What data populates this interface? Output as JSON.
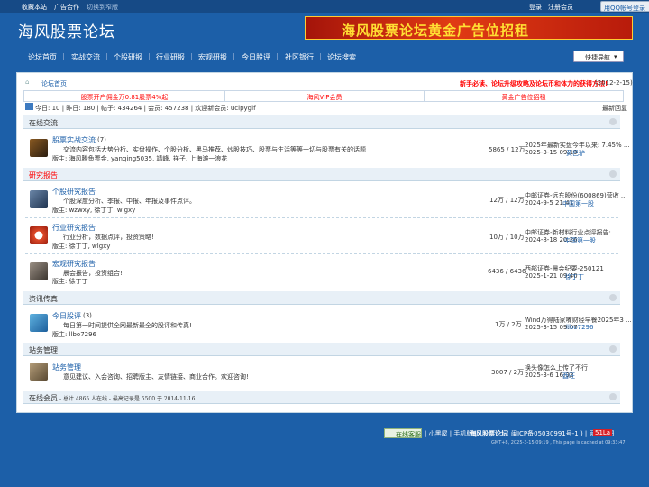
{
  "topbar": {
    "fav": "收藏本站",
    "ads": "广告合作",
    "switch_width": "切换到窄版",
    "login": "登录",
    "register": "注册会员",
    "qq_login": "用QQ帐号登录"
  },
  "logo": "海风股票论坛",
  "banner": "海风股票论坛黄金广告位招租",
  "nav": [
    "论坛首页",
    "实战交流",
    "个股研报",
    "行业研报",
    "宏观研报",
    "今日股评",
    "社区银行",
    "论坛搜索"
  ],
  "quick_nav": "快捷导航",
  "breadcrumb": "论坛首页",
  "notice": "新手必读、论坛升级攻略及论坛币和体力的获得方法!",
  "notice_date": "(2012-2-15)",
  "ads": [
    "股票开户佣金万0.81股票4%起",
    "海风VIP会员",
    "黄金广告位招租"
  ],
  "stats": {
    "text": "今日: 10 | 昨日: 180 | 帖子: 434264 | 会员: 457238 | 欢迎新会员: ucipygif",
    "latest": "最新回复"
  },
  "sections": [
    {
      "name": "在线交流",
      "forums": [
        {
          "title": "股票实战交流",
          "count": "(7)",
          "desc": "交流内容包括大势分析、实盘操作、个股分析、黑马推荐、炒股技巧、股票与生活等等一切与股票有关的话题",
          "mods": "版主: 海风腾鱼票金, yanqing5035, 靖峰, 祥子, 上海滩一浪花",
          "stats": "5865 / 12万",
          "last_title": "2025年最新实盘今年以来: 7.45% ...",
          "last_time": "2025-3-15 09:19",
          "last_user": "黄巴驴"
        }
      ]
    },
    {
      "name": "研究报告",
      "forums": [
        {
          "title": "个股研究报告",
          "count": "",
          "desc": "个股深度分析、季报、中报、年报及事件点评。",
          "mods": "版主: wzwxy, 徐丁丁, wlgxy",
          "stats": "12万 / 12万",
          "last_title": "中邮证券-远东股份(600869)营收 ...",
          "last_time": "2024-9-5 21:41",
          "last_user": "中国第一股"
        },
        {
          "title": "行业研究报告",
          "count": "",
          "desc": "行业分析，数据点评，投资策略!",
          "mods": "版主: 徐丁丁, wlgxy",
          "stats": "10万 / 10万",
          "last_title": "中邮证券-新材料行业点评报告: ...",
          "last_time": "2024-8-18 20:26",
          "last_user": "中国第一股"
        },
        {
          "title": "宏观研究报告",
          "count": "",
          "desc": "晨会报告，投资组合!",
          "mods": "版主: 徐丁丁",
          "stats": "6436 / 6436",
          "last_title": "西部证券-晨会纪要-250121",
          "last_time": "2025-1-21 09:40",
          "last_user": "徐丁丁"
        }
      ]
    },
    {
      "name": "资讯传真",
      "forums": [
        {
          "title": "今日股评",
          "count": "(3)",
          "desc": "每日第一时间提供全网最新最全的股评和传真!",
          "mods": "版主: llbo7296",
          "stats": "1万 / 2万",
          "last_title": "Wind万得陆家嘴财经早餐2025年3 ...",
          "last_time": "2025-3-15 09:07",
          "last_user": "llbo7296"
        }
      ]
    },
    {
      "name": "站务管理",
      "forums": [
        {
          "title": "站务管理",
          "count": "",
          "desc": "意见建议、入会咨询、招聘版主、友情链接、商业合作。欢迎咨询!",
          "mods": "",
          "stats": "3007 / 2万",
          "last_title": "换头像怎么上传了不行",
          "last_time": "2025-3-6 16:02",
          "last_user": "酉旺"
        }
      ]
    }
  ],
  "online": {
    "label": "在线会员",
    "detail": "- 总计 4865 人在线 - 最高记录是 5500 于 2014-11-16."
  },
  "footer": {
    "online_btn": "在线客服",
    "links": "| 小黑屋 | 手机版 |",
    "site": "海风股票论坛",
    "icp": "( 闽ICP备05030991号-1 ) | 网站地图",
    "badge": "51La",
    "gmt": "GMT+8, 2025-3-15 09:19 , This page is cached at 09:33:47"
  }
}
